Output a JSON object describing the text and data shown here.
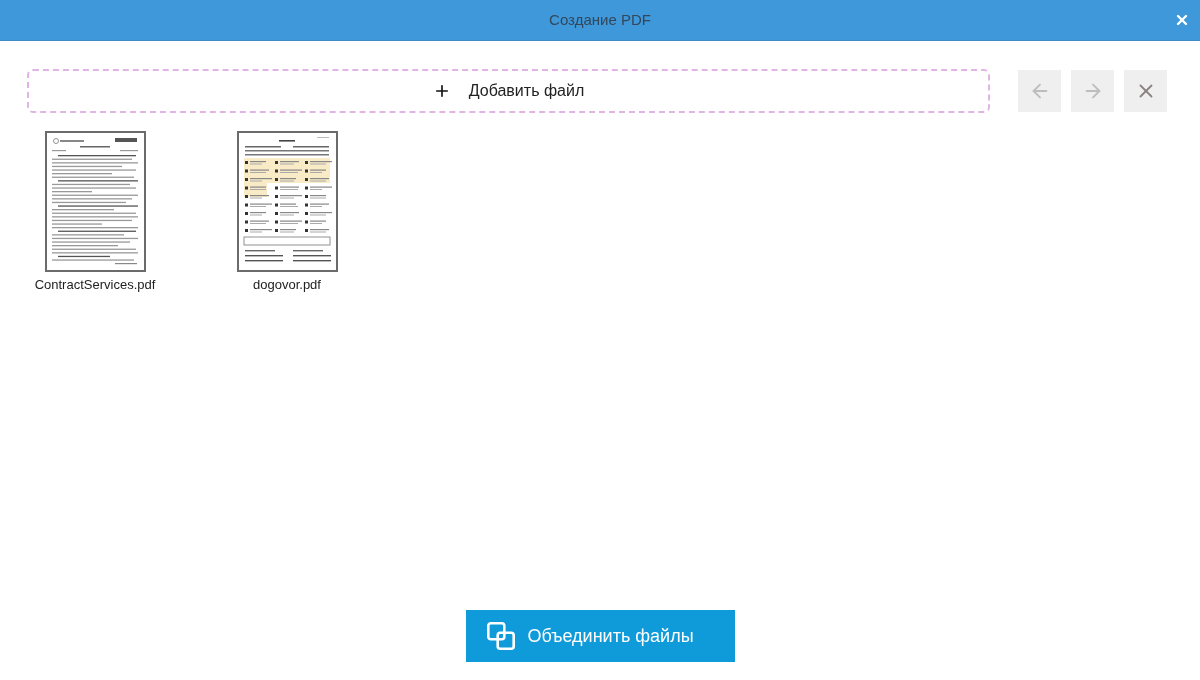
{
  "window": {
    "title": "Создание PDF"
  },
  "add_file": {
    "label": "Добавить файл"
  },
  "toolbar": [
    {
      "kind": "left",
      "disabled": true
    },
    {
      "kind": "right",
      "disabled": true
    },
    {
      "kind": "remove",
      "disabled": false
    }
  ],
  "files": [
    {
      "name": "ContractServices.pdf",
      "kind": "text"
    },
    {
      "name": "dogovor.pdf",
      "kind": "form"
    }
  ],
  "merge_button": {
    "label": "Объединить файлы"
  }
}
